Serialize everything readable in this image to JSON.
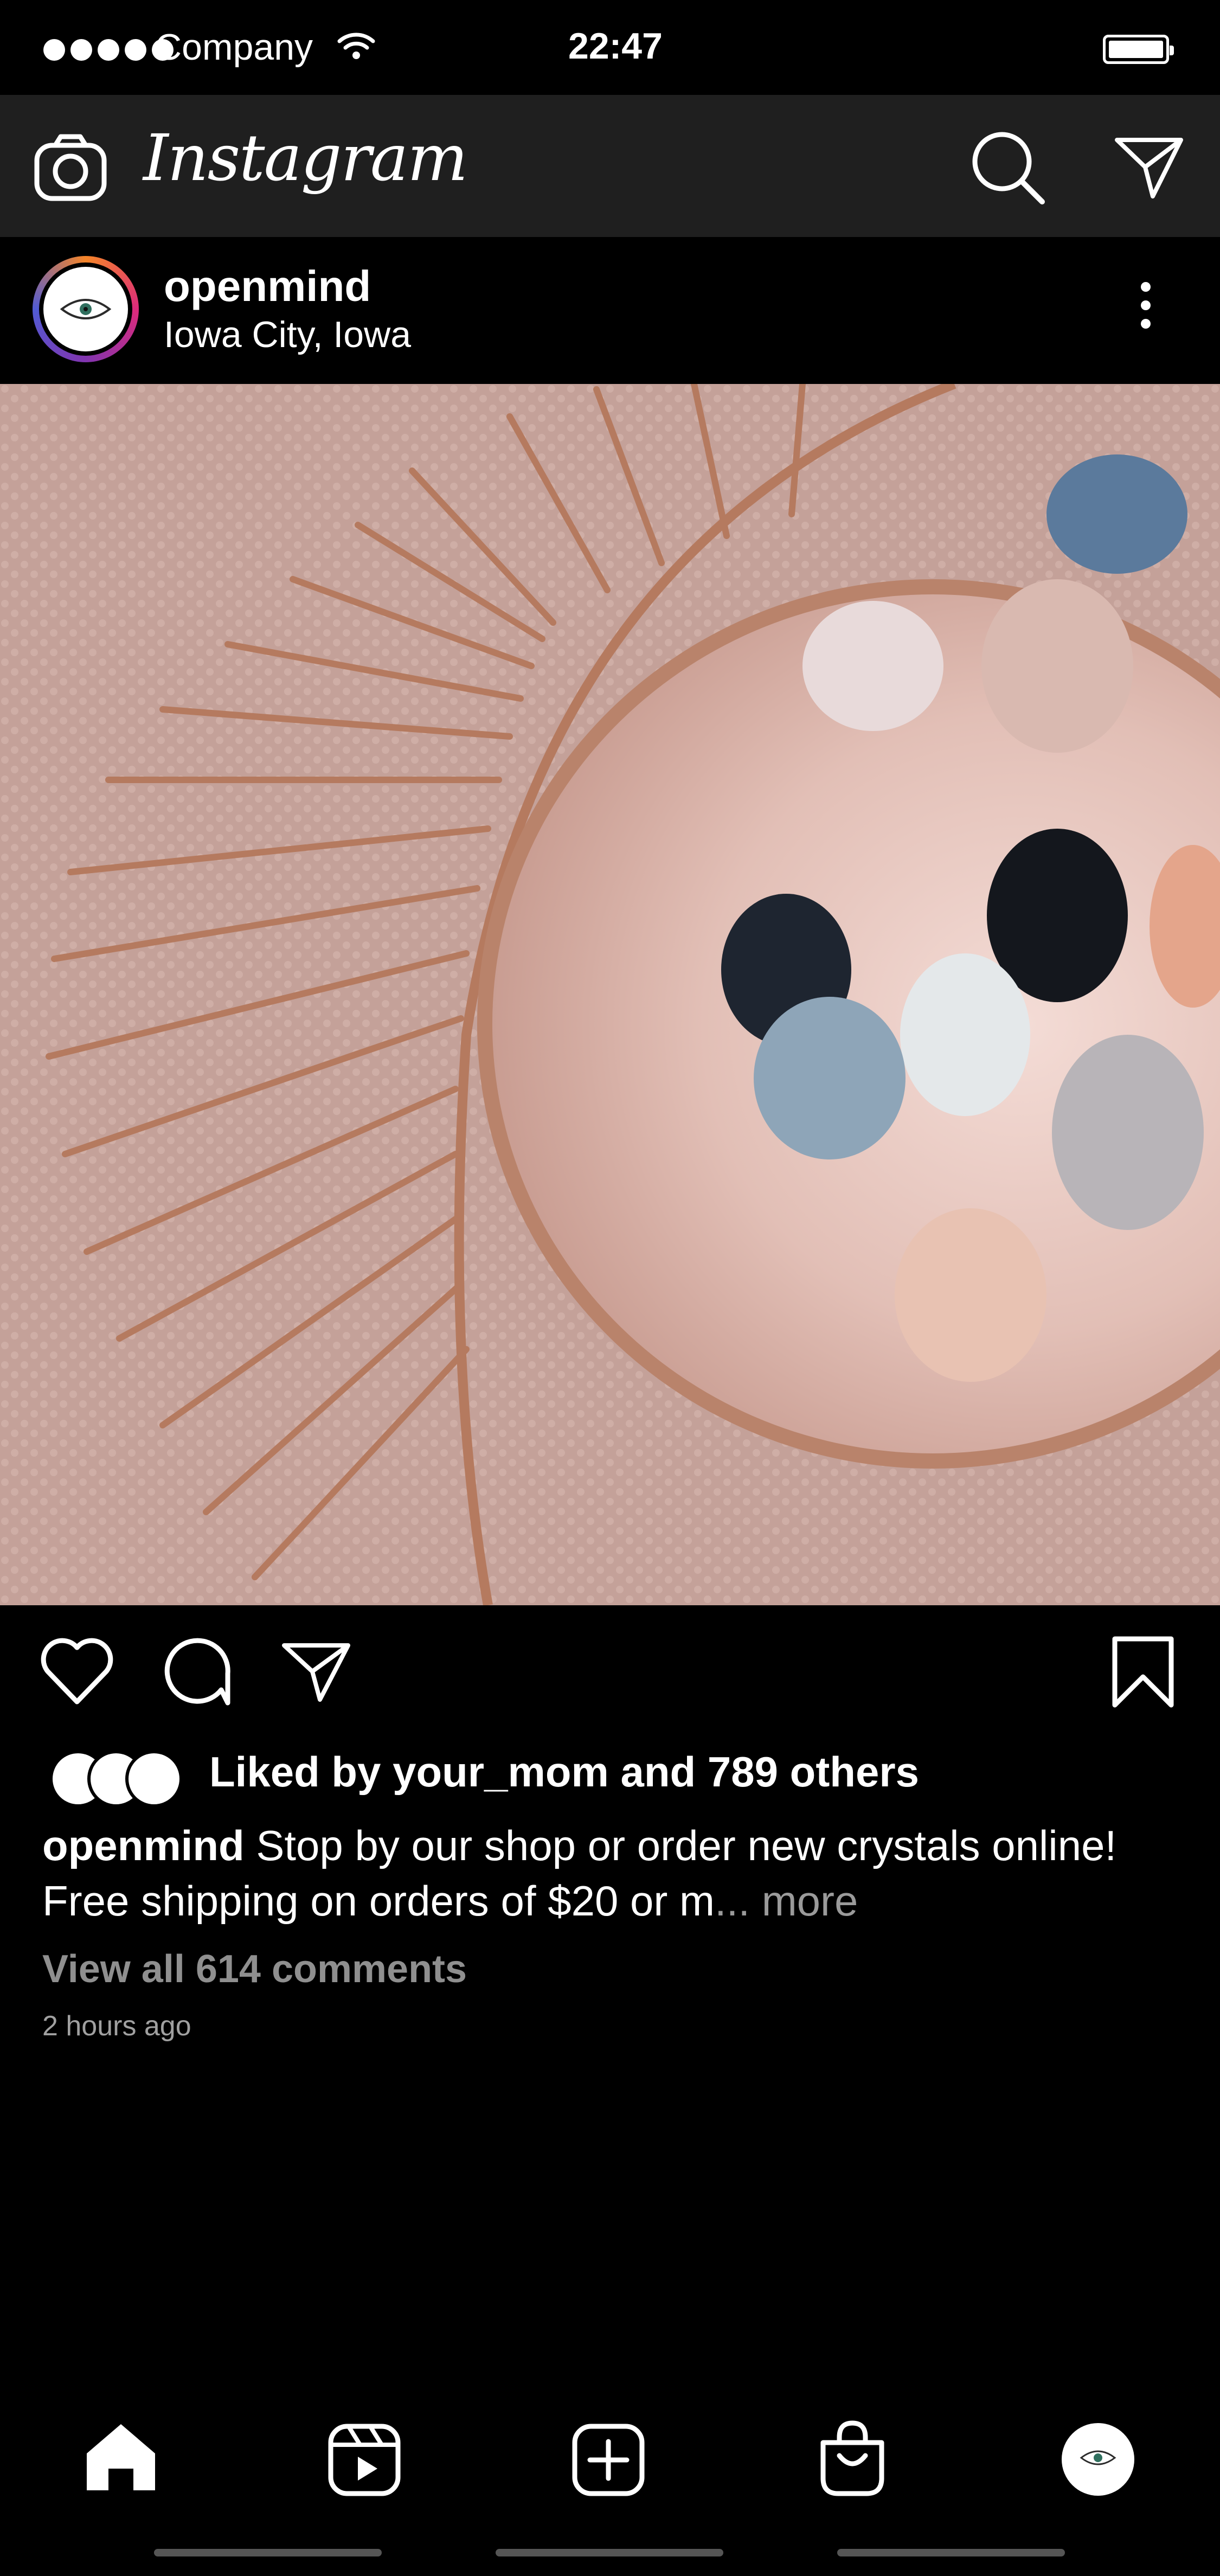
{
  "status_bar": {
    "carrier": "Company",
    "time": "22:47"
  },
  "app_bar": {
    "logo_text": "Instagram",
    "icons": [
      "camera-icon",
      "search-icon",
      "direct-message-icon"
    ]
  },
  "post": {
    "username": "openmind",
    "location": "Iowa City, Iowa",
    "image_alt_subject": "",
    "likes_text": "Liked by your_mom and 789 others",
    "caption_username": "openmind",
    "caption_line1": "Stop by our shop or order new crystals online!",
    "caption_line2": "Free shipping on orders of $20 or m",
    "caption_ellipsis": "... ",
    "caption_more": "more",
    "view_comments": "View all 614 comments",
    "time_ago": "2 hours ago"
  },
  "actions": {
    "icons": [
      "heart-icon",
      "comment-icon",
      "share-icon",
      "bookmark-icon"
    ]
  },
  "bottom_nav": {
    "items": [
      "home-icon",
      "reels-icon",
      "add-post-icon",
      "shop-icon",
      "profile-avatar"
    ]
  },
  "colors": {
    "app_bar_bg": "#1f1f1f",
    "background": "#000000",
    "muted_text": "#9a9a9a"
  }
}
